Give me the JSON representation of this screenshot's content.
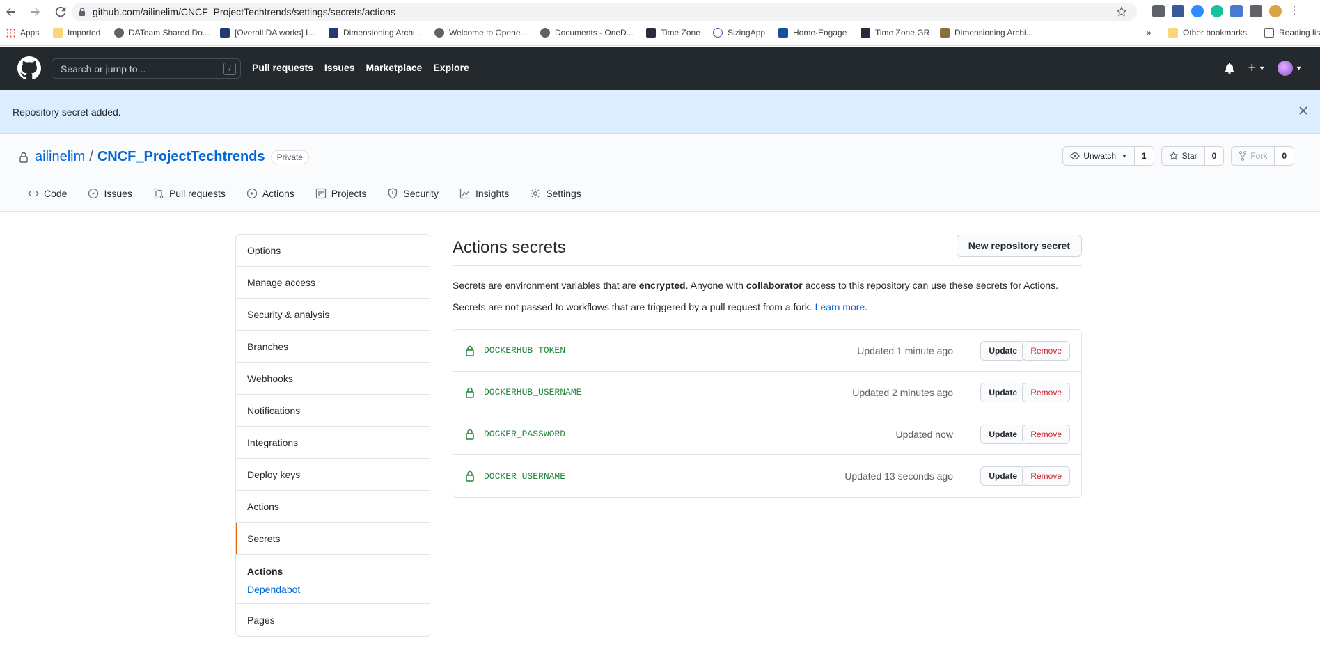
{
  "browser": {
    "url": "github.com/ailinelim/CNCF_ProjectTechtrends/settings/secrets/actions",
    "bookmarks": [
      {
        "label": "Apps",
        "icon": "apps-grid-icon"
      },
      {
        "label": "Imported",
        "icon": "folder-icon"
      },
      {
        "label": "DATeam Shared Do...",
        "icon": "globe-icon"
      },
      {
        "label": "[Overall DA works] I...",
        "icon": "dna-icon"
      },
      {
        "label": "Dimensioning Archi...",
        "icon": "dna-icon"
      },
      {
        "label": "Welcome to Opene...",
        "icon": "globe-icon"
      },
      {
        "label": "Documents - OneD...",
        "icon": "globe-icon"
      },
      {
        "label": "Time Zone",
        "icon": "timezone-icon"
      },
      {
        "label": "SizingApp",
        "icon": "circle-icon"
      },
      {
        "label": "Home-Engage",
        "icon": "sf-icon"
      },
      {
        "label": "Time Zone GR",
        "icon": "timezone-icon"
      },
      {
        "label": "Dimensioning Archi...",
        "icon": "image-icon"
      }
    ],
    "other_bookmarks": "Other bookmarks",
    "reading_list": "Reading lis"
  },
  "header": {
    "search_placeholder": "Search or jump to...",
    "search_key": "/",
    "nav": [
      "Pull requests",
      "Issues",
      "Marketplace",
      "Explore"
    ]
  },
  "flash": {
    "message": "Repository secret added."
  },
  "repo": {
    "owner": "ailinelim",
    "separator": "/",
    "name": "CNCF_ProjectTechtrends",
    "visibility": "Private",
    "watch_label": "Unwatch",
    "watch_count": "1",
    "star_label": "Star",
    "star_count": "0",
    "fork_label": "Fork",
    "fork_count": "0",
    "tabs": [
      {
        "label": "Code",
        "icon": "code-icon"
      },
      {
        "label": "Issues",
        "icon": "issue-icon"
      },
      {
        "label": "Pull requests",
        "icon": "pull-request-icon"
      },
      {
        "label": "Actions",
        "icon": "play-icon"
      },
      {
        "label": "Projects",
        "icon": "project-icon"
      },
      {
        "label": "Security",
        "icon": "shield-icon"
      },
      {
        "label": "Insights",
        "icon": "graph-icon"
      },
      {
        "label": "Settings",
        "icon": "gear-icon"
      }
    ]
  },
  "sidebar": {
    "items": [
      "Options",
      "Manage access",
      "Security & analysis",
      "Branches",
      "Webhooks",
      "Notifications",
      "Integrations",
      "Deploy keys",
      "Actions",
      "Secrets"
    ],
    "selected": "Secrets",
    "group_title": "Actions",
    "group_link": "Dependabot",
    "last_item": "Pages"
  },
  "main": {
    "title": "Actions secrets",
    "new_button": "New repository secret",
    "desc1_pre": "Secrets are environment variables that are ",
    "desc1_b1": "encrypted",
    "desc1_mid": ". Anyone with ",
    "desc1_b2": "collaborator",
    "desc1_post": " access to this repository can use these secrets for Actions.",
    "desc2": "Secrets are not passed to workflows that are triggered by a pull request from a fork.",
    "learn_more": "Learn more",
    "desc2_end": ".",
    "update_label": "Update",
    "remove_label": "Remove",
    "secrets": [
      {
        "name": "DOCKERHUB_TOKEN",
        "updated": "Updated 1 minute ago"
      },
      {
        "name": "DOCKERHUB_USERNAME",
        "updated": "Updated 2 minutes ago"
      },
      {
        "name": "DOCKER_PASSWORD",
        "updated": "Updated now"
      },
      {
        "name": "DOCKER_USERNAME",
        "updated": "Updated 13 seconds ago"
      }
    ]
  },
  "colors": {
    "header_bg": "#24292e",
    "flash_bg": "#dbedff",
    "link": "#0366d6",
    "secret_green": "#22863a",
    "remove_red": "#cb2431",
    "selected_marker": "#e36209"
  }
}
